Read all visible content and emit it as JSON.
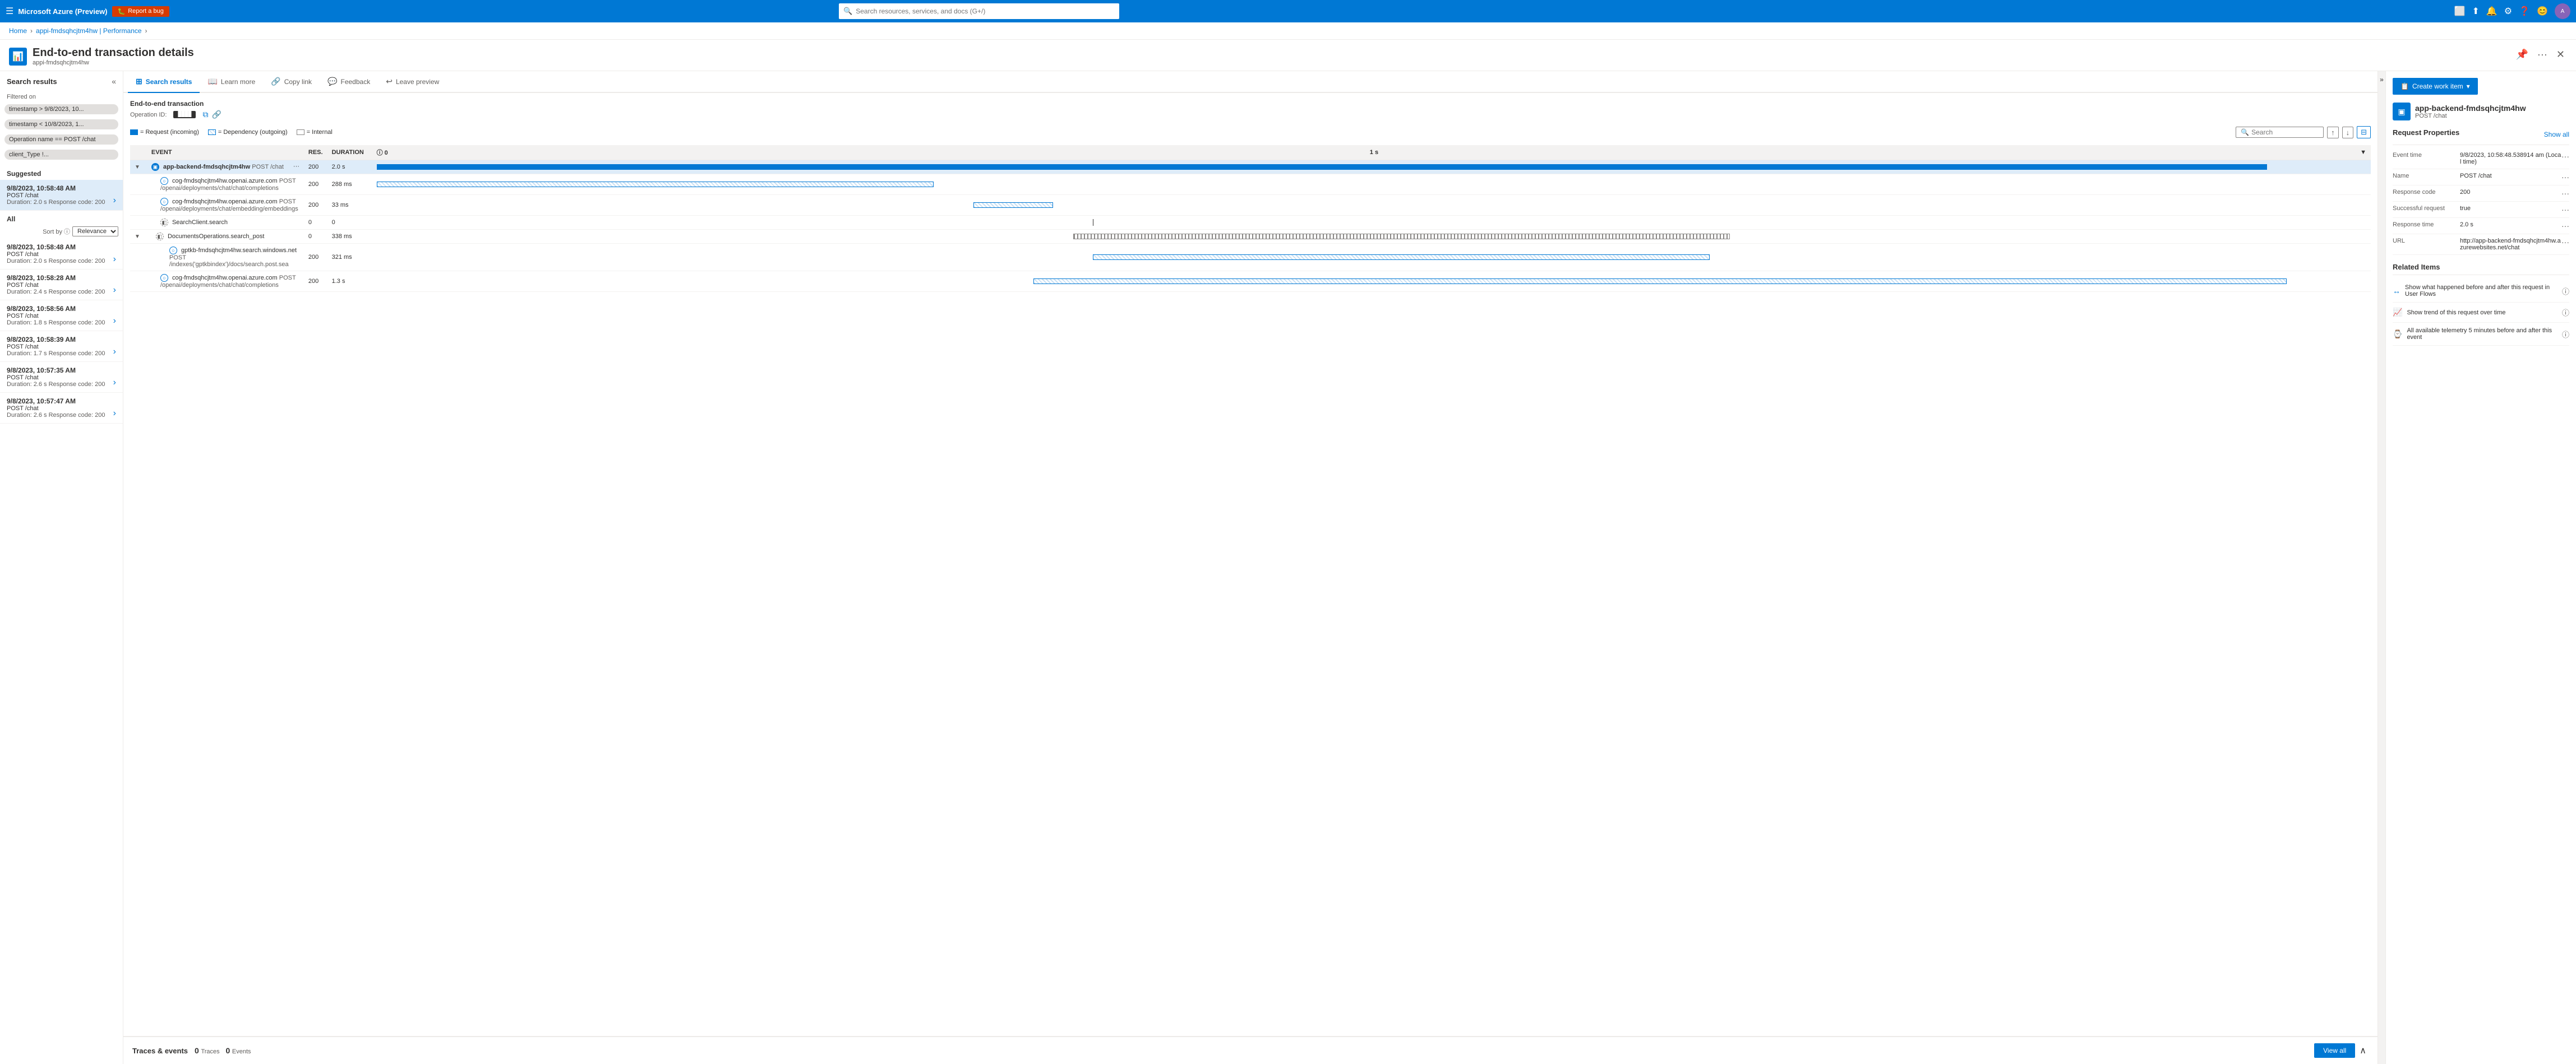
{
  "topnav": {
    "hamburger": "☰",
    "brand": "Microsoft Azure (Preview)",
    "reportBug": "Report a bug",
    "searchPlaceholder": "Search resources, services, and docs (G+/)"
  },
  "breadcrumb": {
    "home": "Home",
    "resource": "appi-fmdsqhcjtm4hw | Performance"
  },
  "pageHeader": {
    "title": "End-to-end transaction details",
    "subtitle": "appi-fmdsqhcjtm4hw",
    "pinLabel": "📌",
    "moreLabel": "···"
  },
  "tabs": [
    {
      "id": "search-results",
      "icon": "⊞",
      "label": "Search results",
      "active": true
    },
    {
      "id": "learn-more",
      "icon": "📖",
      "label": "Learn more",
      "active": false
    },
    {
      "id": "copy-link",
      "icon": "🔗",
      "label": "Copy link",
      "active": false
    },
    {
      "id": "feedback",
      "icon": "💬",
      "label": "Feedback",
      "active": false
    },
    {
      "id": "leave-preview",
      "icon": "↩",
      "label": "Leave preview",
      "active": false
    }
  ],
  "sidebar": {
    "title": "Search results",
    "collapseIcon": "«",
    "filteredOn": "Filtered on",
    "filters": [
      "timestamp > 9/8/2023, 10...",
      "timestamp < 10/8/2023, 1...",
      "Operation name == POST /chat",
      "client_Type !..."
    ],
    "suggested": "Suggested",
    "sortBy": "Sort by ⓘ",
    "sortOptions": [
      "Relevance"
    ],
    "results": [
      {
        "timestamp": "9/8/2023, 10:58:48 AM",
        "method": "POST /chat",
        "meta": "Duration: 2.0 s  Response code: 200",
        "active": true
      },
      {
        "timestamp": "9/8/2023, 10:58:48 AM",
        "method": "POST /chat",
        "meta": "Duration: 2.0 s  Response code: 200",
        "active": false
      },
      {
        "timestamp": "9/8/2023, 10:58:28 AM",
        "method": "POST /chat",
        "meta": "Duration: 2.4 s  Response code: 200",
        "active": false
      },
      {
        "timestamp": "9/8/2023, 10:58:56 AM",
        "method": "POST /chat",
        "meta": "Duration: 1.8 s  Response code: 200",
        "active": false
      },
      {
        "timestamp": "9/8/2023, 10:58:39 AM",
        "method": "POST /chat",
        "meta": "Duration: 1.7 s  Response code: 200",
        "active": false
      },
      {
        "timestamp": "9/8/2023, 10:57:35 AM",
        "method": "POST /chat",
        "meta": "Duration: 2.6 s  Response code: 200",
        "active": false
      },
      {
        "timestamp": "9/8/2023, 10:57:47 AM",
        "method": "POST /chat",
        "meta": "Duration: 2.6 s  Response code: 200",
        "active": false
      }
    ]
  },
  "transaction": {
    "header": "End-to-end transaction",
    "opLabel": "Operation ID:",
    "opId": "████",
    "legend": [
      {
        "type": "req",
        "label": "= Request (incoming)"
      },
      {
        "type": "dep",
        "label": "= Dependency (outgoing)"
      },
      {
        "type": "int",
        "label": "= Internal"
      }
    ],
    "searchPlaceholder": "Search",
    "tableHeaders": [
      "EVENT",
      "RES.",
      "DURATION",
      "",
      "0",
      "1 s"
    ],
    "rows": [
      {
        "indent": 0,
        "expandable": true,
        "expanded": true,
        "iconType": "app",
        "name": "app-backend-fmdsqhcjtm4hw",
        "path": "POST /chat",
        "moreBtn": "···",
        "res": "200",
        "duration": "2.0 s",
        "barType": "solid",
        "barWidth": 95,
        "barOffset": 0
      },
      {
        "indent": 1,
        "expandable": false,
        "iconType": "dep",
        "name": "cog-fmdsqhcjtm4hw.openai.azure.com",
        "path": "POST /openai/deployments/chat/chat/completions",
        "res": "200",
        "duration": "288 ms",
        "barType": "hatched",
        "barWidth": 28,
        "barOffset": 0
      },
      {
        "indent": 1,
        "expandable": false,
        "iconType": "dep",
        "name": "cog-fmdsqhcjtm4hw.openai.azure.com",
        "path": "POST /openai/deployments/chat/embedding/embeddings",
        "res": "200",
        "duration": "33 ms",
        "barType": "hatched",
        "barWidth": 4,
        "barOffset": 30
      },
      {
        "indent": 1,
        "expandable": false,
        "iconType": "search",
        "name": "SearchClient.search",
        "path": "",
        "res": "0",
        "duration": "0",
        "barType": "line",
        "barWidth": 1,
        "barOffset": 36
      },
      {
        "indent": 1,
        "expandable": true,
        "expanded": true,
        "iconType": "doc",
        "name": "DocumentsOperations.search_post",
        "path": "",
        "res": "0",
        "duration": "338 ms",
        "barType": "dotted",
        "barWidth": 33,
        "barOffset": 35
      },
      {
        "indent": 2,
        "expandable": false,
        "iconType": "dep",
        "name": "gptkb-fmdsqhcjtm4hw.search.windows.net",
        "path": "POST /indexes('gptkbindex')/docs/search.post.sea",
        "res": "200",
        "duration": "321 ms",
        "barType": "hatched",
        "barWidth": 31,
        "barOffset": 36
      },
      {
        "indent": 1,
        "expandable": false,
        "iconType": "dep",
        "name": "cog-fmdsqhcjtm4hw.openai.azure.com",
        "path": "POST /openai/deployments/chat/chat/completions",
        "res": "200",
        "duration": "1.3 s",
        "barType": "hatched",
        "barWidth": 65,
        "barOffset": 33
      }
    ]
  },
  "traces": {
    "label": "Traces & events",
    "traces": 0,
    "tracesLabel": "Traces",
    "events": 0,
    "eventsLabel": "Events",
    "viewAll": "View all"
  },
  "rightPanel": {
    "createWorkItem": "Create work item",
    "appName": "app-backend-fmdsqhcjtm4hw",
    "appSubtitle": "POST /chat",
    "requestPropertiesTitle": "Request Properties",
    "showAll": "Show all",
    "properties": [
      {
        "label": "Event time",
        "value": "9/8/2023, 10:58:48.538914 am (Local time)"
      },
      {
        "label": "Name",
        "value": "POST /chat"
      },
      {
        "label": "Response code",
        "value": "200"
      },
      {
        "label": "Successful request",
        "value": "true"
      },
      {
        "label": "Response time",
        "value": "2.0 s"
      },
      {
        "label": "URL",
        "value": "http://app-backend-fmdsqhcjtm4hw.azurewebsites.net/chat"
      }
    ],
    "relatedItems": {
      "title": "Related Items",
      "items": [
        {
          "text": "Show what happened before and after this request in User Flows"
        },
        {
          "text": "Show trend of this request over time"
        },
        {
          "text": "All available telemetry 5 minutes before and after this event"
        }
      ]
    }
  }
}
